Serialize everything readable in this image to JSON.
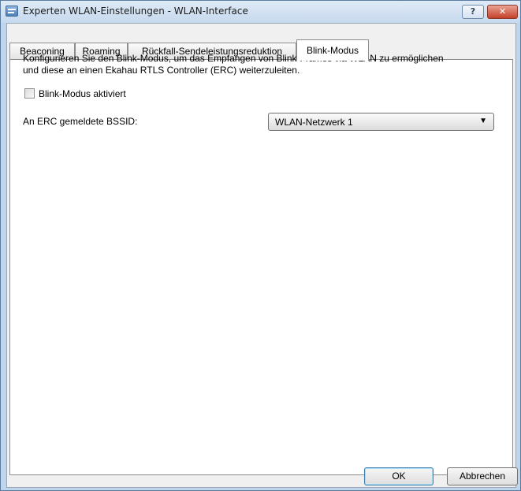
{
  "window": {
    "title": "Experten WLAN-Einstellungen - WLAN-Interface",
    "help_label": "?",
    "close_label": "✕"
  },
  "tabs": [
    {
      "label": "Beaconing",
      "active": false
    },
    {
      "label": "Roaming",
      "active": false
    },
    {
      "label": "Rückfall-Sendeleistungsreduktion",
      "active": false
    },
    {
      "label": "Blink-Modus",
      "active": true
    }
  ],
  "panel": {
    "description_line1": "Konfigurieren Sie den Blink-Modus, um das Empfangen von Blink-Frames via WLAN zu ermöglichen",
    "description_line2": "und diese an einen Ekahau RTLS Controller (ERC) weiterzuleiten.",
    "blink_checkbox_label": "Blink-Modus aktiviert",
    "blink_checkbox_checked": false,
    "bssid_label": "An ERC gemeldete BSSID:",
    "bssid_value": "WLAN-Netzwerk 1"
  },
  "buttons": {
    "ok": "OK",
    "cancel": "Abbrechen"
  }
}
